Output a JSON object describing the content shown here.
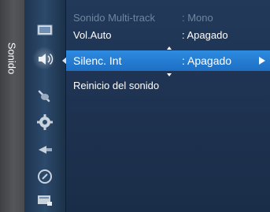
{
  "sidebar": {
    "category_label": "Sonido",
    "icons": [
      {
        "name": "picture-icon"
      },
      {
        "name": "sound-icon"
      },
      {
        "name": "channel-icon"
      },
      {
        "name": "setup-icon"
      },
      {
        "name": "input-icon"
      },
      {
        "name": "application-icon"
      },
      {
        "name": "support-icon"
      }
    ]
  },
  "menu": {
    "items": [
      {
        "label": "Sonido Multi-track",
        "value": ": Mono",
        "state": "disabled"
      },
      {
        "label": "Vol.Auto",
        "value": ": Apagado",
        "state": "normal"
      },
      {
        "label": "Silenc. Int",
        "value": ": Apagado",
        "state": "selected"
      },
      {
        "label": "Reinicio del sonido",
        "value": "",
        "state": "normal"
      }
    ]
  },
  "colors": {
    "panel_bg": "#1f3453",
    "highlight": "#2d8be0",
    "disabled_text": "#6f85a0",
    "side_tab": "#4a4b4f"
  }
}
